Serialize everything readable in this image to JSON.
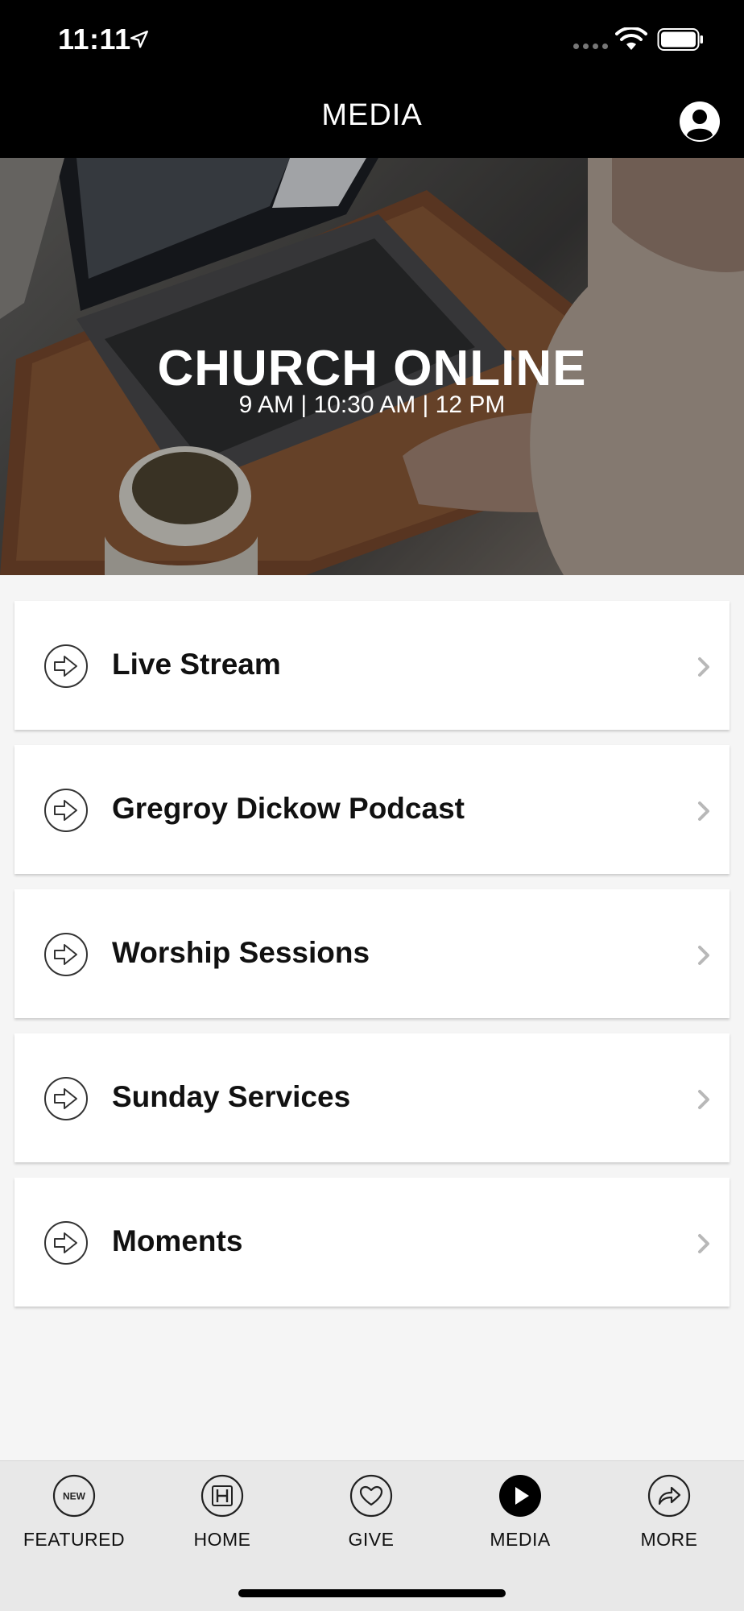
{
  "status_bar": {
    "time": "11:11"
  },
  "header": {
    "title": "MEDIA"
  },
  "banner": {
    "title": "CHURCH ONLINE",
    "subtitle": "9 AM | 10:30 AM | 12 PM"
  },
  "list": {
    "items": [
      {
        "label": "Live Stream",
        "icon": "arrow-right-circle-icon"
      },
      {
        "label": "Gregroy Dickow Podcast",
        "icon": "arrow-right-circle-icon"
      },
      {
        "label": "Worship Sessions",
        "icon": "arrow-right-circle-icon"
      },
      {
        "label": "Sunday Services",
        "icon": "arrow-right-circle-icon"
      },
      {
        "label": "Moments",
        "icon": "arrow-right-circle-icon"
      }
    ]
  },
  "tabbar": {
    "tabs": [
      {
        "label": "FEATURED",
        "icon": "new-badge-icon",
        "badge": "NEW"
      },
      {
        "label": "HOME",
        "icon": "h-logo-icon"
      },
      {
        "label": "GIVE",
        "icon": "heart-icon"
      },
      {
        "label": "MEDIA",
        "icon": "play-icon",
        "active": true
      },
      {
        "label": "MORE",
        "icon": "share-arrow-icon"
      }
    ]
  },
  "colors": {
    "header_bg": "#000000",
    "page_bg": "#f5f5f5",
    "tabbar_bg": "#e8e8e8",
    "active_tab": "#000000"
  }
}
